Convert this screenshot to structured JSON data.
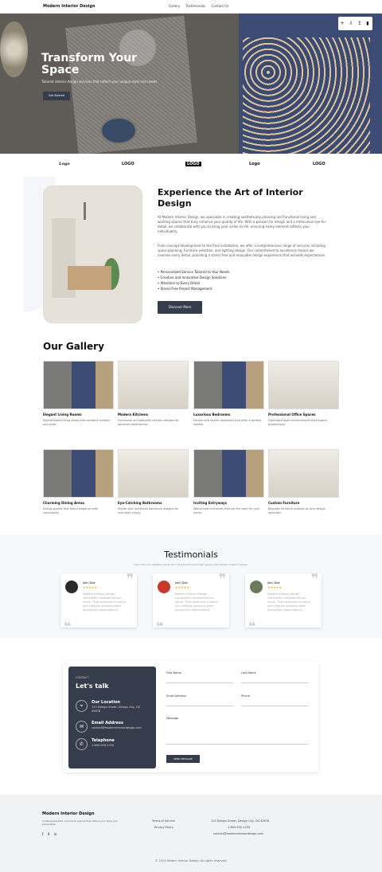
{
  "nav": {
    "brand": "Modern Interior Design",
    "links": [
      "Gallery",
      "Testimonials",
      "Contact Us"
    ]
  },
  "hero": {
    "title": "Transform Your Space",
    "subtitle": "Tailored interior design services that reflect your unique style and needs.",
    "cta": "Get Started",
    "tools": "+ ⇩ ↥ ▮"
  },
  "logos": [
    "Logo",
    "LOGO",
    "LOGO",
    "Logo",
    "LOGO"
  ],
  "about": {
    "title": "Experience the Art of Interior Design",
    "p1": "At Modern Interior Design, we specialize in creating aesthetically pleasing and functional living and working spaces that truly enhance your quality of life. With a passion for design and a meticulous eye for detail, we collaborate with you to bring your vision to life, ensuring every element reflects your individuality.",
    "p2": "From concept development to the final installation, we offer a comprehensive range of services including space planning, furniture selection, and lighting design. Our commitment to excellence means we oversee every detail, providing a stress-free and enjoyable design experience that exceeds expectations.",
    "list": [
      "Personalized Service Tailored to Your Needs",
      "Creative and Innovative Design Solutions",
      "Attention to Every Detail",
      "Stress-Free Project Management"
    ],
    "cta": "Discover More"
  },
  "gallery": {
    "title": "Our Gallery",
    "items": [
      {
        "t": "Elegant Living Rooms",
        "d": "Sophisticated living areas that combine comfort and style."
      },
      {
        "t": "Modern Kitchens",
        "d": "Functional and beautiful kitchen designs for gourmet experiences."
      },
      {
        "t": "Luxurious Bedrooms",
        "d": "Serene and stylish bedrooms that offer a perfect retreat."
      },
      {
        "t": "Professional Office Spaces",
        "d": "Optimized work environments that inspire productivity."
      },
      {
        "t": "Charming Dining Areas",
        "d": "Dining spaces that blend elegance with conviviality."
      },
      {
        "t": "Eye-Catching Bathrooms",
        "d": "Stylish and functional bathroom designs for everyday luxury."
      },
      {
        "t": "Inviting Entryways",
        "d": "Welcoming entrances that set the tone for your home."
      },
      {
        "t": "Custom Furniture",
        "d": "Bespoke furniture tailored to your design aesthetic."
      }
    ]
  },
  "testimonials": {
    "title": "Testimonials",
    "subtitle": "Hear from our satisfied clients who have transformed their spaces with Modern Interior Design.",
    "items": [
      {
        "name": "John Doe",
        "stars": "★★★★★",
        "text": "Modern Interior Design completely transformed our home. Their attention to detail and creative solutions were beyond our expectations.",
        "color": "#2a2a2a"
      },
      {
        "name": "John Doe",
        "stars": "★★★★★",
        "text": "Modern Interior Design completely transformed our home. Their attention to detail and creative solutions were beyond our expectations.",
        "color": "#c8392b"
      },
      {
        "name": "John Doe",
        "stars": "★★★★★",
        "text": "Modern Interior Design completely transformed our home. Their attention to detail and creative solutions were beyond our expectations.",
        "color": "#6b7b5a"
      }
    ]
  },
  "contact": {
    "kicker": "CONTACT",
    "title": "Let's talk",
    "loc_t": "Our Location",
    "loc_v": "123 Design Street, Design City, DS 45678",
    "email_t": "Email Address",
    "email_v": "contact@moderninteriordesign.com",
    "tel_t": "Telephone",
    "tel_v": "1-800-918-1234",
    "first": "First Name",
    "last": "Last Name",
    "email": "Email Address",
    "phone": "Phone",
    "message": "Message",
    "send": "SEND MESSAGE"
  },
  "footer": {
    "brand": "Modern Interior Design",
    "desc": "Crafting beautiful, functional spaces that reflect your style and personality.",
    "social": [
      "f",
      "X",
      "in"
    ],
    "terms": "Terms of Service",
    "privacy": "Privacy Policy",
    "addr": "123 Design Street, Design City, DS 45678",
    "tel": "1-800-555-1234",
    "email": "contact@moderninteriordesign.com",
    "copy": "© 2024 Modern Interior Design. All rights reserved."
  }
}
